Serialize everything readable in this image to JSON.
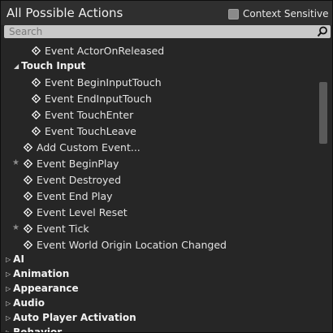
{
  "panel": {
    "title": "All Possible Actions",
    "context_sensitive_label": "Context Sensitive",
    "context_sensitive_checked": false
  },
  "search": {
    "placeholder": "Search"
  },
  "items": [
    {
      "kind": "event",
      "label": "Event ActorOnReleased",
      "indent": 2,
      "starred": false
    },
    {
      "kind": "subcategory",
      "label": "Touch Input",
      "expanded": true
    },
    {
      "kind": "event",
      "label": "Event BeginInputTouch",
      "indent": 2,
      "starred": false
    },
    {
      "kind": "event",
      "label": "Event EndInputTouch",
      "indent": 2,
      "starred": false
    },
    {
      "kind": "event",
      "label": "Event TouchEnter",
      "indent": 2,
      "starred": false
    },
    {
      "kind": "event",
      "label": "Event TouchLeave",
      "indent": 2,
      "starred": false
    },
    {
      "kind": "event",
      "label": "Add Custom Event...",
      "indent": 1,
      "starred": false
    },
    {
      "kind": "event",
      "label": "Event BeginPlay",
      "indent": 1,
      "starred": true
    },
    {
      "kind": "event",
      "label": "Event Destroyed",
      "indent": 1,
      "starred": false
    },
    {
      "kind": "event",
      "label": "Event End Play",
      "indent": 1,
      "starred": false
    },
    {
      "kind": "event",
      "label": "Event Level Reset",
      "indent": 1,
      "starred": false
    },
    {
      "kind": "event",
      "label": "Event Tick",
      "indent": 1,
      "starred": true
    },
    {
      "kind": "event",
      "label": "Event World Origin Location Changed",
      "indent": 1,
      "starred": false
    },
    {
      "kind": "category",
      "label": "AI",
      "expanded": false
    },
    {
      "kind": "category",
      "label": "Animation",
      "expanded": false
    },
    {
      "kind": "category",
      "label": "Appearance",
      "expanded": false
    },
    {
      "kind": "category",
      "label": "Audio",
      "expanded": false
    },
    {
      "kind": "category",
      "label": "Auto Player Activation",
      "expanded": false
    },
    {
      "kind": "category",
      "label": "Behavior",
      "expanded": false
    }
  ],
  "colors": {
    "background": "#262626",
    "header": "#2f2f2f",
    "search_bg": "#c8c8c8"
  },
  "icons": {
    "search": "search-icon",
    "event": "event-diamond-icon",
    "favorite": "star-icon"
  }
}
